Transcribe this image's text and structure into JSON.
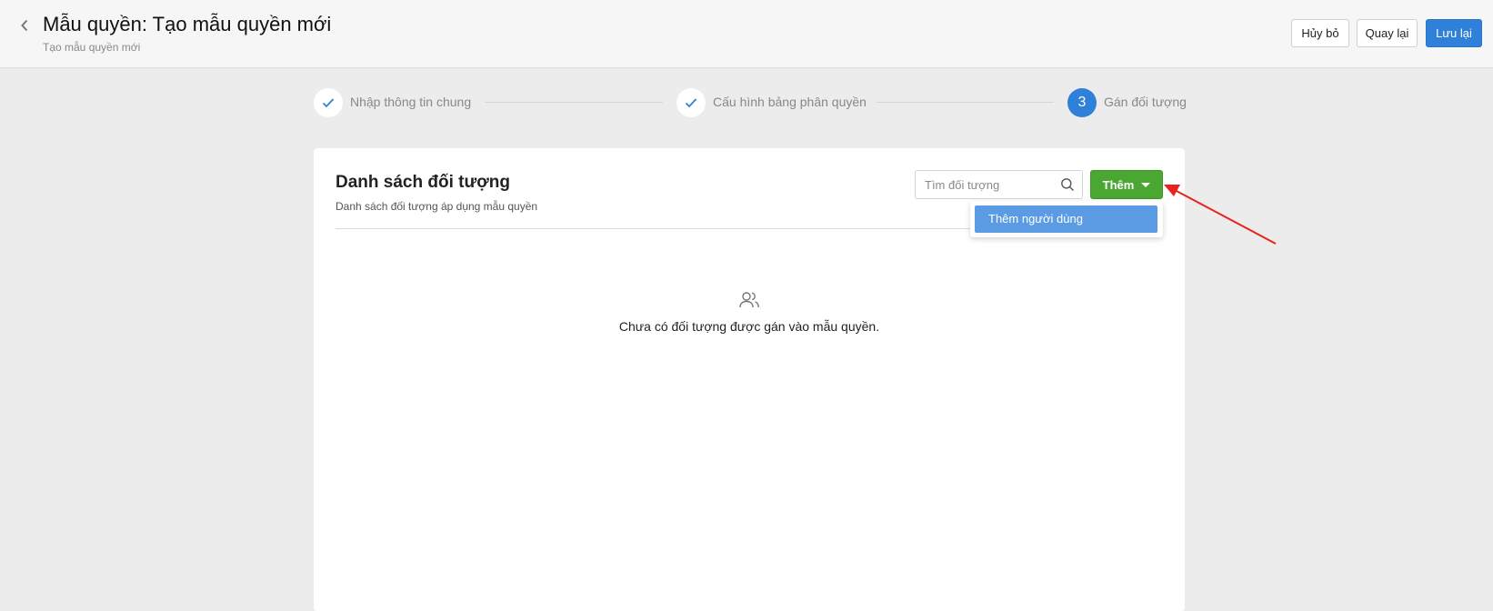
{
  "header": {
    "title": "Mẫu quyền: Tạo mẫu quyền mới",
    "subtitle": "Tạo mẫu quyền mới",
    "back_icon": "chevron-left-icon",
    "buttons": {
      "cancel": "Hủy bỏ",
      "back": "Quay lại",
      "save": "Lưu lại"
    }
  },
  "steps": [
    {
      "label": "Nhập thông tin chung",
      "status": "done",
      "icon": "check-icon"
    },
    {
      "label": "Cấu hình bảng phân quyền",
      "status": "done",
      "icon": "check-icon"
    },
    {
      "label": "Gán đối tượng",
      "status": "active",
      "number": "3"
    }
  ],
  "card": {
    "title": "Danh sách đối tượng",
    "subtitle": "Danh sách đối tượng áp dụng mẫu quyền",
    "search": {
      "placeholder": "Tìm đối tượng",
      "value": "",
      "icon": "search-icon"
    },
    "add_button": {
      "label": "Thêm",
      "icon": "caret-down-icon"
    },
    "dropdown": {
      "items": [
        "Thêm người dùng"
      ]
    },
    "empty_state": {
      "icon": "users-icon",
      "text": "Chưa có đối tượng được gán vào mẫu quyền."
    }
  },
  "colors": {
    "primary": "#2f80d9",
    "success": "#4aa832",
    "dropdown_highlight": "#5b9be3",
    "annotation_arrow": "#e8231f"
  }
}
